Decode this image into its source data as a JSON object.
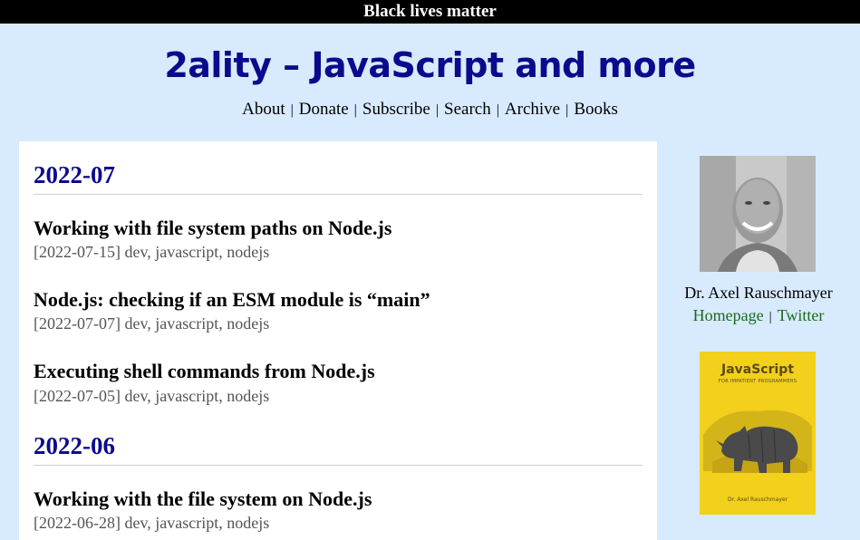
{
  "banner": {
    "text": "Black lives matter"
  },
  "site": {
    "title": "2ality – JavaScript and more"
  },
  "nav": {
    "items": [
      "About",
      "Donate",
      "Subscribe",
      "Search",
      "Archive",
      "Books"
    ],
    "separator": "|"
  },
  "archive": {
    "months": [
      {
        "label": "2022-07",
        "posts": [
          {
            "title": "Working with file system paths on Node.js",
            "date": "[2022-07-15]",
            "tags": "dev, javascript, nodejs"
          },
          {
            "title": "Node.js: checking if an ESM module is “main”",
            "date": "[2022-07-07]",
            "tags": "dev, javascript, nodejs"
          },
          {
            "title": "Executing shell commands from Node.js",
            "date": "[2022-07-05]",
            "tags": "dev, javascript, nodejs"
          }
        ]
      },
      {
        "label": "2022-06",
        "posts": [
          {
            "title": "Working with the file system on Node.js",
            "date": "[2022-06-28]",
            "tags": "dev, javascript, nodejs"
          }
        ]
      }
    ]
  },
  "sidebar": {
    "author": "Dr. Axel Rauschmayer",
    "links": [
      "Homepage",
      "Twitter"
    ],
    "book": {
      "title": "JavaScript",
      "subtitle": "FOR IMPATIENT PROGRAMMERS",
      "author": "Dr. Axel Rauschmayer"
    }
  },
  "colors": {
    "background": "#d8eafe",
    "title": "#0c0a8c",
    "link_green": "#1a6b1a",
    "book_yellow": "#f2d01b"
  }
}
